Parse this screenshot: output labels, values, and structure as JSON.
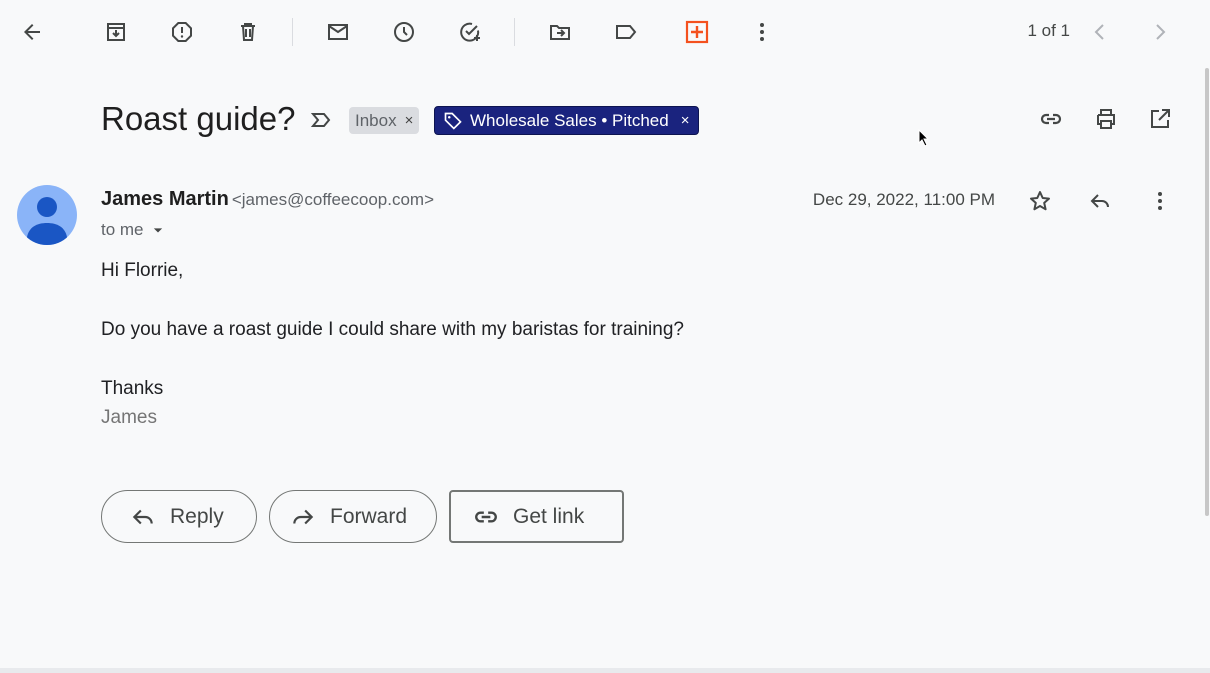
{
  "toolbar": {
    "back_icon": "arrow-back-icon",
    "archive_icon": "archive-icon",
    "spam_icon": "report-spam-icon",
    "delete_icon": "delete-icon",
    "mark_unread_icon": "mail-icon",
    "snooze_icon": "clock-icon",
    "add_task_icon": "add-task-icon",
    "move_icon": "move-to-folder-icon",
    "label_icon": "label-icon",
    "addon_icon": "orange-plus-box-icon",
    "more_icon": "more-vert-icon",
    "page_counter": "1 of 1",
    "older_icon": "chevron-left-icon",
    "newer_icon": "chevron-right-icon",
    "addon_color": "#f4511e"
  },
  "thread": {
    "subject": "Roast guide?",
    "importance_icon": "importance-marker-icon",
    "labels": [
      {
        "text": "Inbox",
        "close": "×",
        "color": "#dadce0"
      },
      {
        "text": "Wholesale Sales • Pitched",
        "close": "×",
        "color": "#1a237e",
        "icon": "tag-icon"
      }
    ],
    "link_icon": "link-icon",
    "print_icon": "print-icon",
    "open_new_window_icon": "open-in-new-icon"
  },
  "message": {
    "sender_name": "James Martin",
    "sender_email": "<james@coffeecoop.com>",
    "recipient": "to me",
    "date": "Dec 29, 2022, 11:00 PM",
    "star_icon": "star-outline-icon",
    "reply_icon": "reply-icon",
    "more_icon": "more-vert-icon",
    "body": {
      "greeting": "Hi Florrie,",
      "line1": "Do you have a roast guide I could share with my baristas for training?",
      "closing": "Thanks",
      "signature": "James"
    }
  },
  "actions": {
    "reply_label": "Reply",
    "forward_label": "Forward",
    "get_link_label": "Get link"
  }
}
